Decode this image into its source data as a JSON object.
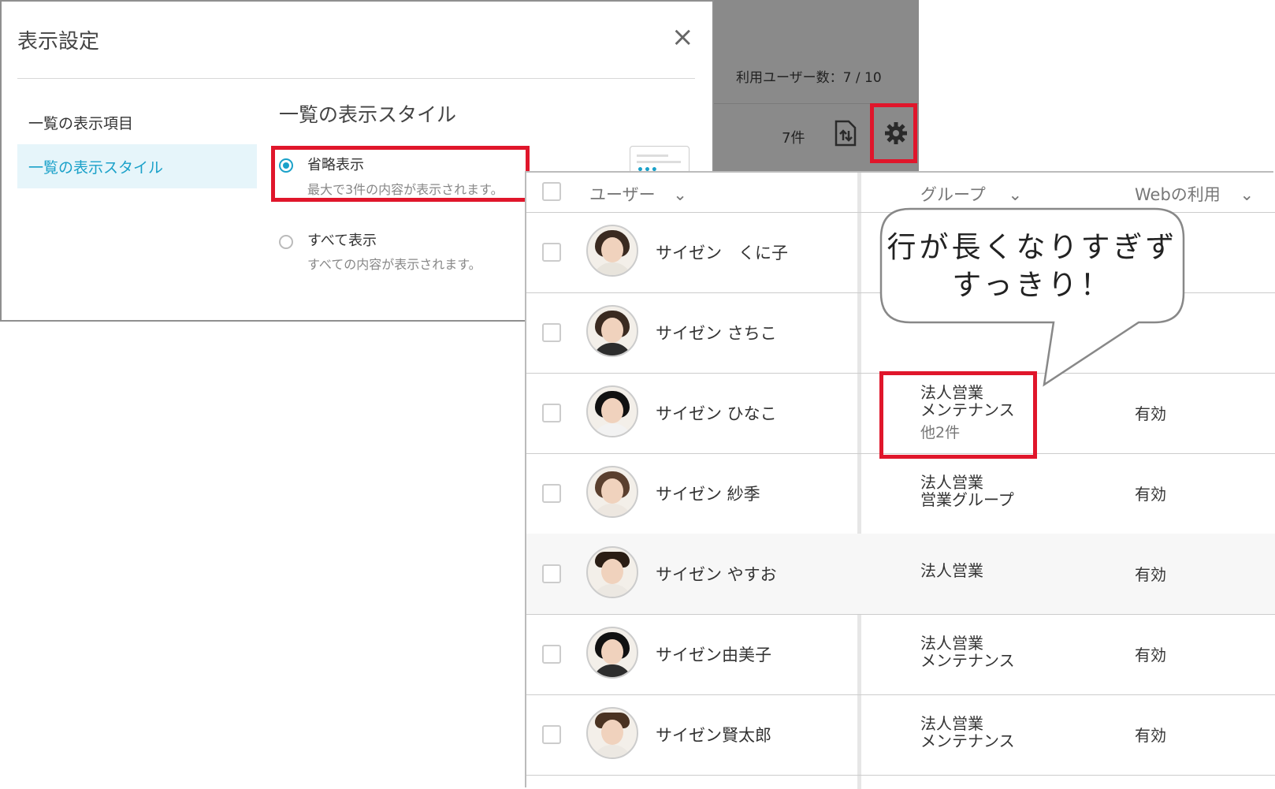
{
  "dialog": {
    "title": "表示設定",
    "close_symbol": "×",
    "menu": [
      {
        "label": "一覧の表示項目"
      },
      {
        "label": "一覧の表示スタイル"
      }
    ],
    "section_title": "一覧の表示スタイル",
    "options": [
      {
        "label": "省略表示",
        "description": "最大で3件の内容が表示されます。",
        "selected": true
      },
      {
        "label": "すべて表示",
        "description": "すべての内容が表示されます。",
        "selected": false
      }
    ]
  },
  "header": {
    "user_count": "利用ユーザー数：7 / 10",
    "item_count": "7件",
    "icons": [
      "export-icon",
      "gear-icon"
    ]
  },
  "table": {
    "columns": [
      "ユーザー",
      "グループ",
      "Webの利用"
    ],
    "rows": [
      {
        "name": "サイゼン　くに子",
        "groups": [],
        "more": "",
        "web": ""
      },
      {
        "name": "サイゼン さちこ",
        "groups": [],
        "more": "",
        "web": ""
      },
      {
        "name": "サイゼン ひなこ",
        "groups": [
          "法人営業",
          "メンテナンス"
        ],
        "more": "他2件",
        "web": "有効"
      },
      {
        "name": "サイゼン 紗季",
        "groups": [
          "法人営業",
          "営業グループ"
        ],
        "more": "",
        "web": "有効"
      },
      {
        "name": "サイゼン やすお",
        "groups": [
          "法人営業"
        ],
        "more": "",
        "web": "有効"
      },
      {
        "name": "サイゼン由美子",
        "groups": [
          "法人営業",
          "メンテナンス"
        ],
        "more": "",
        "web": "有効"
      },
      {
        "name": "サイゼン賢太郎",
        "groups": [
          "法人営業",
          "メンテナンス"
        ],
        "more": "",
        "web": "有効"
      }
    ]
  },
  "callout": {
    "line1": "行が長くなりすぎず",
    "line2": "すっきり！"
  },
  "colors": {
    "accent": "#1aa1c9",
    "highlight": "#e0162b",
    "header_panel": "#8a8a8a"
  }
}
